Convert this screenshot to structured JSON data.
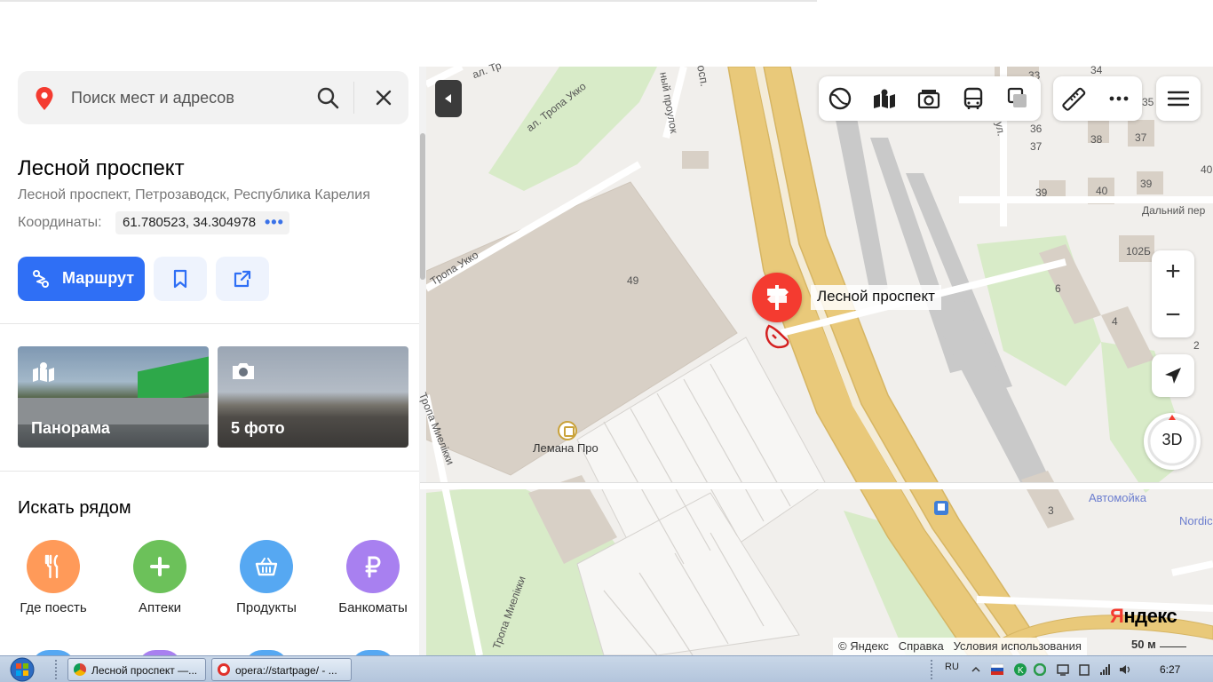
{
  "search": {
    "placeholder": "Поиск мест и адресов"
  },
  "place": {
    "title": "Лесной проспект",
    "address": "Лесной проспект, Петрозаводск, Республика Карелия",
    "coords_label": "Координаты:",
    "coords_value": "61.780523, 34.304978",
    "coords_more": "•••"
  },
  "actions": {
    "route_label": "Маршрут"
  },
  "photos": [
    {
      "label": "Панорама",
      "icon": "panorama-icon"
    },
    {
      "label": "5 фото",
      "icon": "camera-icon"
    }
  ],
  "nearby": {
    "title": "Искать рядом",
    "categories": [
      {
        "label": "Где поесть",
        "color": "#ff9a59",
        "icon": "fork-knife-icon"
      },
      {
        "label": "Аптеки",
        "color": "#6cc15a",
        "icon": "plus-icon"
      },
      {
        "label": "Продукты",
        "color": "#56a8f2",
        "icon": "basket-icon"
      },
      {
        "label": "Банкоматы",
        "color": "#a880f0",
        "icon": "ruble-icon"
      }
    ]
  },
  "map": {
    "marker_label": "Лесной проспект",
    "streets": {
      "tropa_ukko_top": "ал. Тропа Укко",
      "tropa_ukko_left": "Тропа Укко",
      "tropa_mielikki": "Тропа Миелікки",
      "tropa_mielikki_2": "Тропа Миелікки",
      "dalniy": "Дальний пер",
      "pereulok": "ный проулок",
      "prosp": "осп.",
      "ul": "ул.",
      "al_top": "ал. Тр"
    },
    "buildings": [
      "49",
      "33",
      "34",
      "35",
      "36",
      "37",
      "38",
      "37",
      "39",
      "40",
      "39",
      "40",
      "102Б",
      "6",
      "4",
      "2",
      "3"
    ],
    "poi_lemana": "Лемана Про",
    "autowash": "Автомойка",
    "nordic": "Nordic",
    "logo": "Яндекс",
    "copyright": "© Яндекс",
    "help": "Справка",
    "terms": "Условия использования",
    "scale": "50 м",
    "btn_3d": "3D",
    "zoom_in": "+",
    "zoom_out": "−"
  },
  "taskbar": {
    "tasks": [
      {
        "label": "Лесной проспект —...",
        "icon_color": "#4a8be0"
      },
      {
        "label": "opera://startpage/ - ...",
        "icon_color": "#e0302a"
      }
    ],
    "lang": "RU",
    "time": "6:27"
  },
  "colors": {
    "accent_blue": "#2f6ff5",
    "marker_red": "#f43b30",
    "road_yellow": "#e9c97a"
  }
}
